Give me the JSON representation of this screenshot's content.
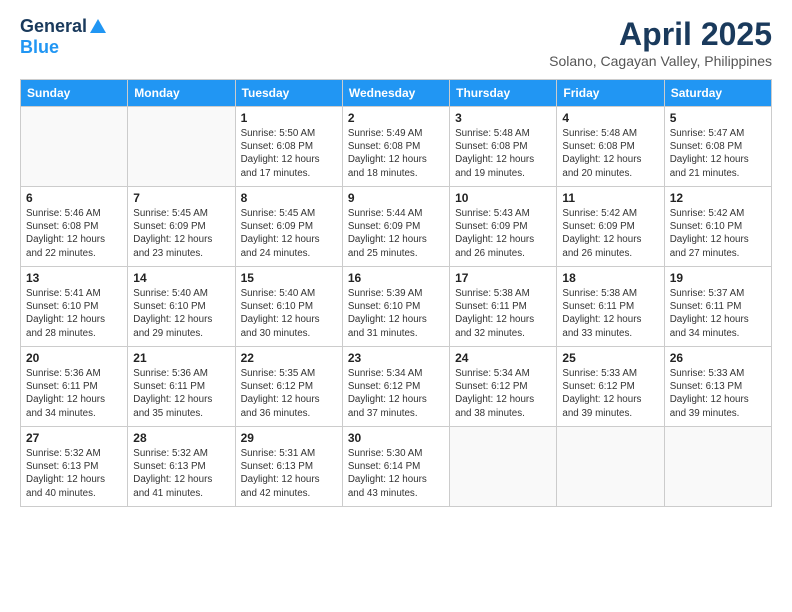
{
  "header": {
    "logo_general": "General",
    "logo_blue": "Blue",
    "month_title": "April 2025",
    "subtitle": "Solano, Cagayan Valley, Philippines"
  },
  "days_of_week": [
    "Sunday",
    "Monday",
    "Tuesday",
    "Wednesday",
    "Thursday",
    "Friday",
    "Saturday"
  ],
  "weeks": [
    [
      {
        "day": "",
        "info": ""
      },
      {
        "day": "",
        "info": ""
      },
      {
        "day": "1",
        "info": "Sunrise: 5:50 AM\nSunset: 6:08 PM\nDaylight: 12 hours and 17 minutes."
      },
      {
        "day": "2",
        "info": "Sunrise: 5:49 AM\nSunset: 6:08 PM\nDaylight: 12 hours and 18 minutes."
      },
      {
        "day": "3",
        "info": "Sunrise: 5:48 AM\nSunset: 6:08 PM\nDaylight: 12 hours and 19 minutes."
      },
      {
        "day": "4",
        "info": "Sunrise: 5:48 AM\nSunset: 6:08 PM\nDaylight: 12 hours and 20 minutes."
      },
      {
        "day": "5",
        "info": "Sunrise: 5:47 AM\nSunset: 6:08 PM\nDaylight: 12 hours and 21 minutes."
      }
    ],
    [
      {
        "day": "6",
        "info": "Sunrise: 5:46 AM\nSunset: 6:08 PM\nDaylight: 12 hours and 22 minutes."
      },
      {
        "day": "7",
        "info": "Sunrise: 5:45 AM\nSunset: 6:09 PM\nDaylight: 12 hours and 23 minutes."
      },
      {
        "day": "8",
        "info": "Sunrise: 5:45 AM\nSunset: 6:09 PM\nDaylight: 12 hours and 24 minutes."
      },
      {
        "day": "9",
        "info": "Sunrise: 5:44 AM\nSunset: 6:09 PM\nDaylight: 12 hours and 25 minutes."
      },
      {
        "day": "10",
        "info": "Sunrise: 5:43 AM\nSunset: 6:09 PM\nDaylight: 12 hours and 26 minutes."
      },
      {
        "day": "11",
        "info": "Sunrise: 5:42 AM\nSunset: 6:09 PM\nDaylight: 12 hours and 26 minutes."
      },
      {
        "day": "12",
        "info": "Sunrise: 5:42 AM\nSunset: 6:10 PM\nDaylight: 12 hours and 27 minutes."
      }
    ],
    [
      {
        "day": "13",
        "info": "Sunrise: 5:41 AM\nSunset: 6:10 PM\nDaylight: 12 hours and 28 minutes."
      },
      {
        "day": "14",
        "info": "Sunrise: 5:40 AM\nSunset: 6:10 PM\nDaylight: 12 hours and 29 minutes."
      },
      {
        "day": "15",
        "info": "Sunrise: 5:40 AM\nSunset: 6:10 PM\nDaylight: 12 hours and 30 minutes."
      },
      {
        "day": "16",
        "info": "Sunrise: 5:39 AM\nSunset: 6:10 PM\nDaylight: 12 hours and 31 minutes."
      },
      {
        "day": "17",
        "info": "Sunrise: 5:38 AM\nSunset: 6:11 PM\nDaylight: 12 hours and 32 minutes."
      },
      {
        "day": "18",
        "info": "Sunrise: 5:38 AM\nSunset: 6:11 PM\nDaylight: 12 hours and 33 minutes."
      },
      {
        "day": "19",
        "info": "Sunrise: 5:37 AM\nSunset: 6:11 PM\nDaylight: 12 hours and 34 minutes."
      }
    ],
    [
      {
        "day": "20",
        "info": "Sunrise: 5:36 AM\nSunset: 6:11 PM\nDaylight: 12 hours and 34 minutes."
      },
      {
        "day": "21",
        "info": "Sunrise: 5:36 AM\nSunset: 6:11 PM\nDaylight: 12 hours and 35 minutes."
      },
      {
        "day": "22",
        "info": "Sunrise: 5:35 AM\nSunset: 6:12 PM\nDaylight: 12 hours and 36 minutes."
      },
      {
        "day": "23",
        "info": "Sunrise: 5:34 AM\nSunset: 6:12 PM\nDaylight: 12 hours and 37 minutes."
      },
      {
        "day": "24",
        "info": "Sunrise: 5:34 AM\nSunset: 6:12 PM\nDaylight: 12 hours and 38 minutes."
      },
      {
        "day": "25",
        "info": "Sunrise: 5:33 AM\nSunset: 6:12 PM\nDaylight: 12 hours and 39 minutes."
      },
      {
        "day": "26",
        "info": "Sunrise: 5:33 AM\nSunset: 6:13 PM\nDaylight: 12 hours and 39 minutes."
      }
    ],
    [
      {
        "day": "27",
        "info": "Sunrise: 5:32 AM\nSunset: 6:13 PM\nDaylight: 12 hours and 40 minutes."
      },
      {
        "day": "28",
        "info": "Sunrise: 5:32 AM\nSunset: 6:13 PM\nDaylight: 12 hours and 41 minutes."
      },
      {
        "day": "29",
        "info": "Sunrise: 5:31 AM\nSunset: 6:13 PM\nDaylight: 12 hours and 42 minutes."
      },
      {
        "day": "30",
        "info": "Sunrise: 5:30 AM\nSunset: 6:14 PM\nDaylight: 12 hours and 43 minutes."
      },
      {
        "day": "",
        "info": ""
      },
      {
        "day": "",
        "info": ""
      },
      {
        "day": "",
        "info": ""
      }
    ]
  ]
}
